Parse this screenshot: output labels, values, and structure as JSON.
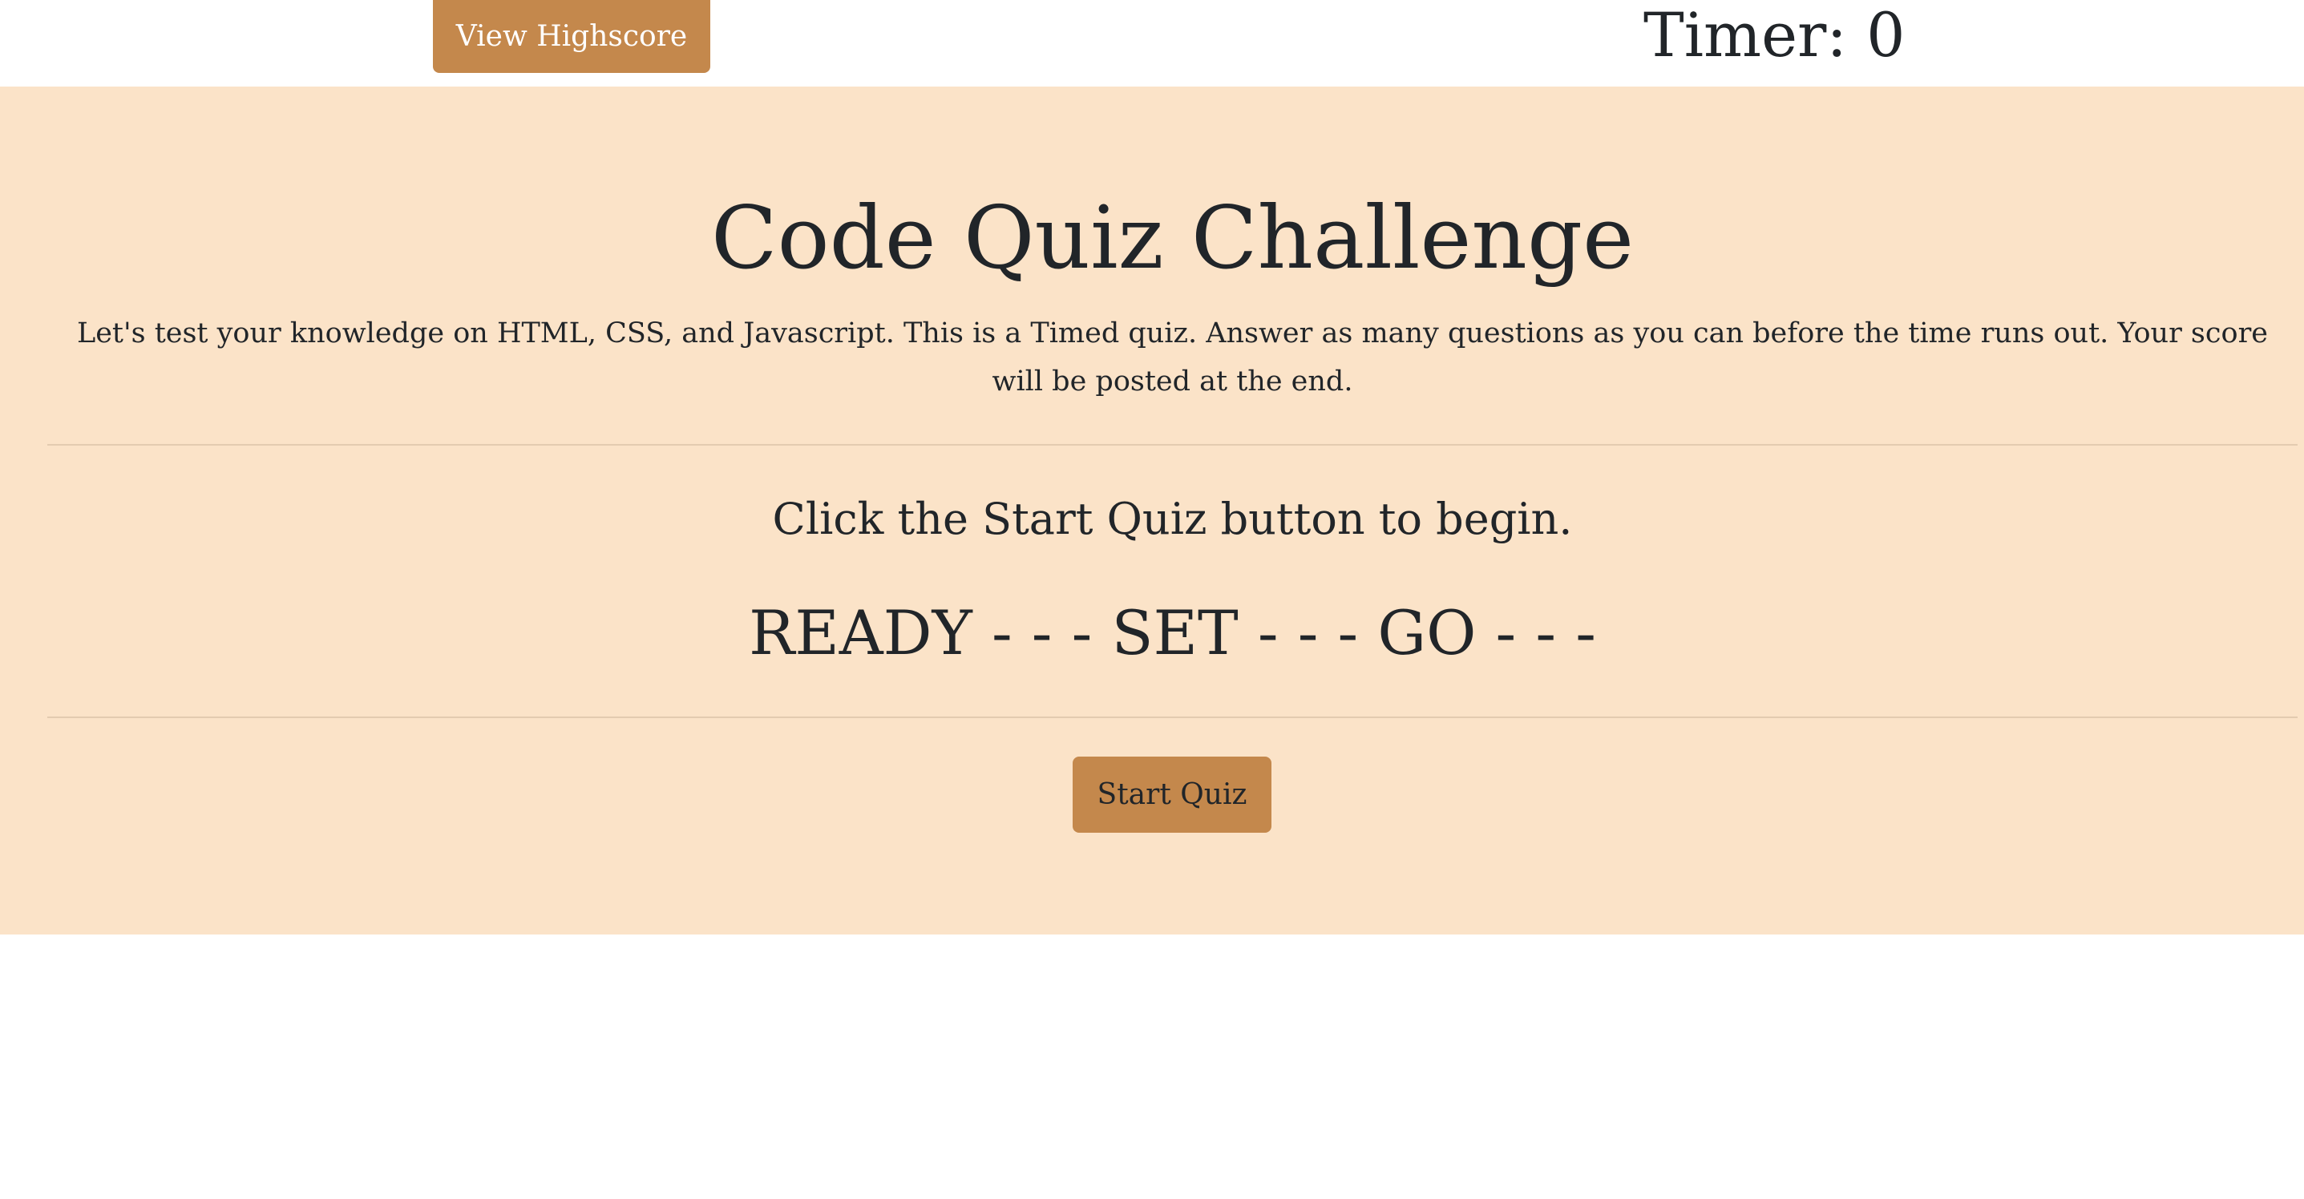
{
  "header": {
    "highscore_label": "View Highscore",
    "timer_label": "Timer: 0"
  },
  "main": {
    "title": "Code Quiz Challenge",
    "intro": "Let's test your knowledge on HTML, CSS, and Javascript. This is a Timed quiz. Answer as many questions as you can before the time runs out. Your score will be posted at the end.",
    "instruction": "Click the Start Quiz button to begin.",
    "ready_text": "READY - - - SET - - - GO - - -",
    "start_label": "Start Quiz"
  },
  "colors": {
    "button": "#c4884c",
    "panel_background": "#fbe3c8",
    "text": "#212529"
  }
}
